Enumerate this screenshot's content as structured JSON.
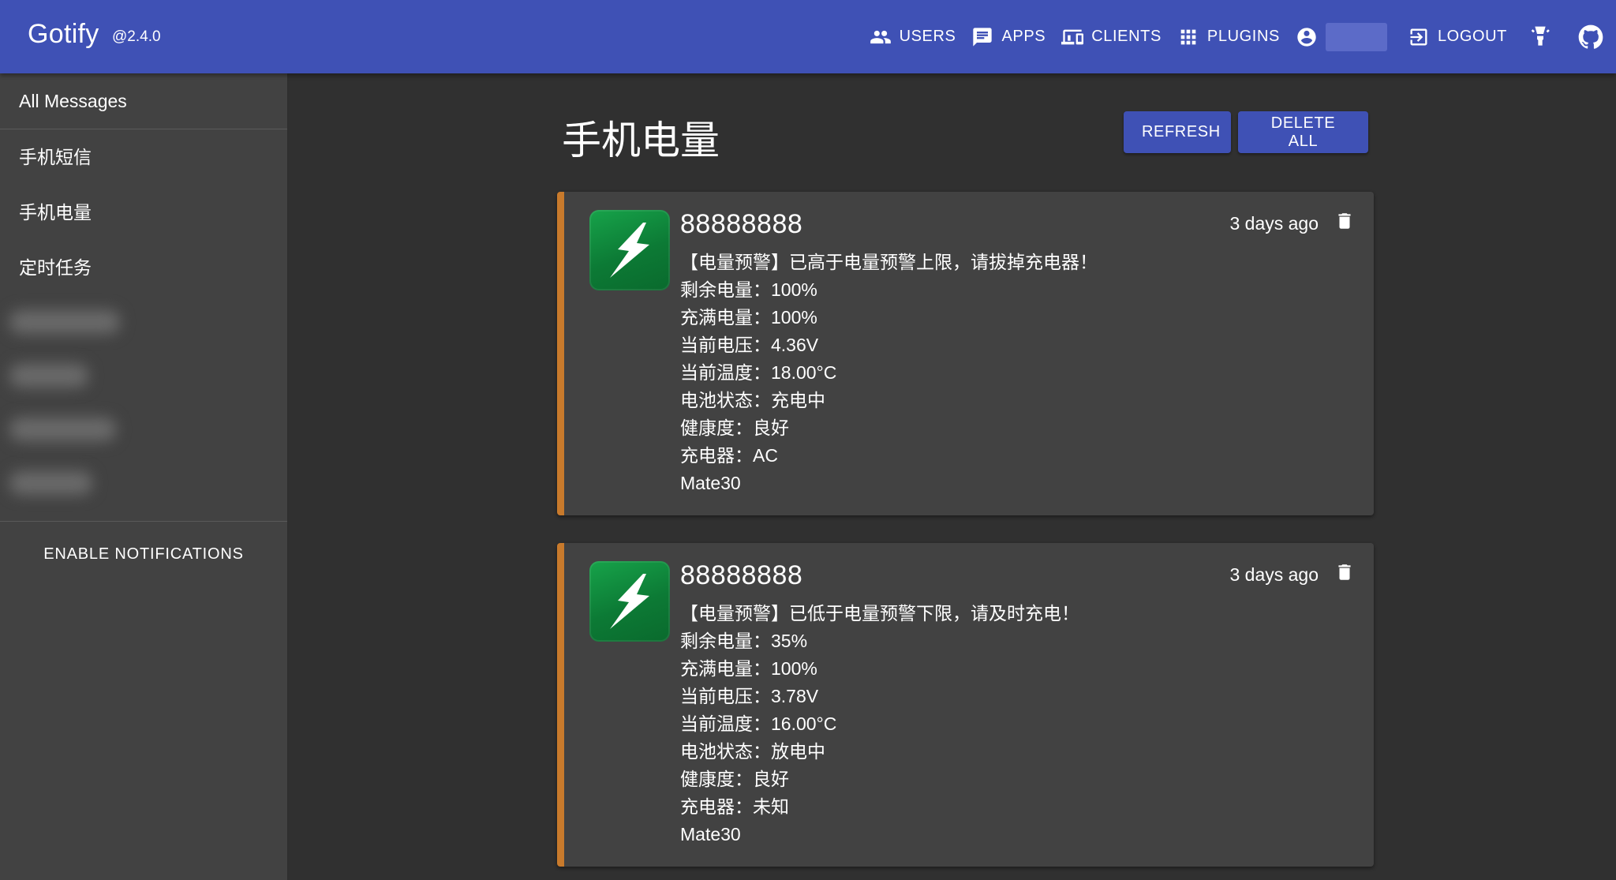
{
  "header": {
    "brand": "Gotify",
    "version": "@2.4.0",
    "nav": {
      "users": "USERS",
      "apps": "APPS",
      "clients": "CLIENTS",
      "plugins": "PLUGINS",
      "logout": "LOGOUT"
    },
    "icons": [
      "users-icon",
      "chat-icon",
      "devices-icon",
      "grid-icon",
      "account-circle-icon",
      "logout-icon",
      "lightbulb-icon",
      "github-icon"
    ]
  },
  "sidebar": {
    "all_messages": "All Messages",
    "apps": [
      {
        "label": "手机短信"
      },
      {
        "label": "手机电量"
      },
      {
        "label": "定时任务"
      }
    ],
    "enable_notifications": "ENABLE NOTIFICATIONS"
  },
  "main": {
    "title": "手机电量",
    "refresh": "REFRESH",
    "delete_all": "DELETE ALL"
  },
  "messages": [
    {
      "title": "88888888",
      "date": "3 days ago",
      "lines": [
        "【电量预警】已高于电量预警上限，请拔掉充电器！",
        "剩余电量：100%",
        "充满电量：100%",
        "当前电压：4.36V",
        "当前温度：18.00°C",
        "电池状态：充电中",
        "健康度：良好",
        "充电器：AC",
        "Mate30"
      ]
    },
    {
      "title": "88888888",
      "date": "3 days ago",
      "lines": [
        "【电量预警】已低于电量预警下限，请及时充电！",
        "剩余电量：35%",
        "充满电量：100%",
        "当前电压：3.78V",
        "当前温度：16.00°C",
        "电池状态：放电中",
        "健康度：良好",
        "充电器：未知",
        "Mate30"
      ]
    }
  ],
  "colors": {
    "appbar": "#3f51b5",
    "background": "#303030",
    "sidebar": "#424242",
    "card": "#424242",
    "card_accent": "#c87a2c",
    "app_icon": "#0c7a35"
  }
}
